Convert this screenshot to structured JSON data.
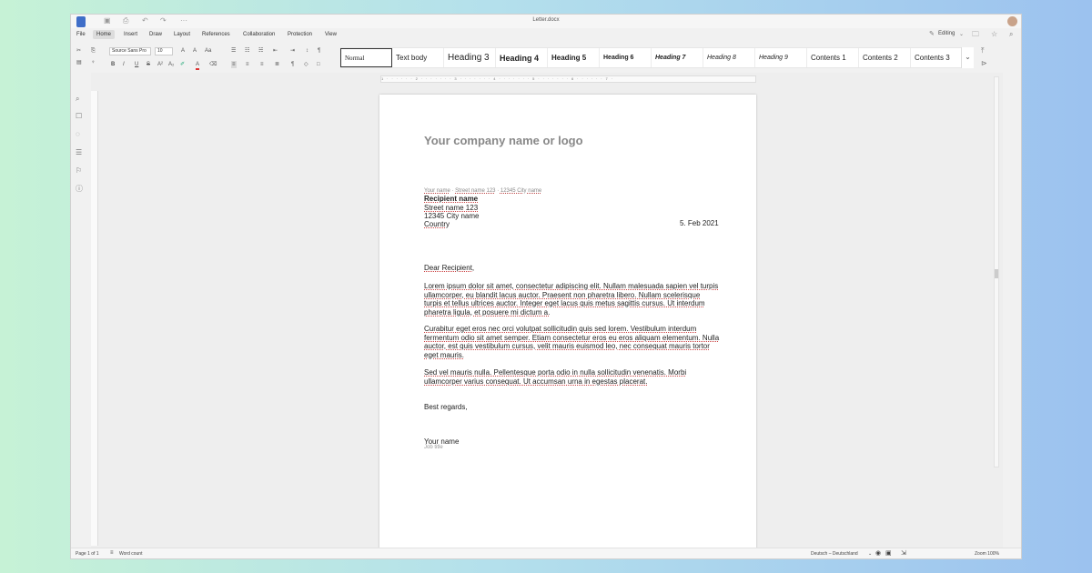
{
  "window": {
    "title": "Letter.docx",
    "zoom": "Zoom 100%"
  },
  "quick_access": {
    "more": "···"
  },
  "menu": {
    "items": [
      {
        "label": "File"
      },
      {
        "label": "Home"
      },
      {
        "label": "Insert"
      },
      {
        "label": "Draw"
      },
      {
        "label": "Layout"
      },
      {
        "label": "References"
      },
      {
        "label": "Collaboration"
      },
      {
        "label": "Protection"
      },
      {
        "label": "View"
      }
    ],
    "active": "Home",
    "editing": "Editing"
  },
  "toolbar": {
    "font": "Source Sans Pro",
    "size": "10",
    "bold": "B",
    "italic": "I",
    "underline": "U",
    "strike": "S",
    "superscript": "A²",
    "subscript": "A₂",
    "font_color": "A"
  },
  "styles": [
    {
      "label": "Normal"
    },
    {
      "label": "Text body"
    },
    {
      "label": "Heading 3"
    },
    {
      "label": "Heading 4"
    },
    {
      "label": "Heading 5"
    },
    {
      "label": "Heading 6"
    },
    {
      "label": "Heading 7"
    },
    {
      "label": "Heading 8"
    },
    {
      "label": "Heading 9"
    },
    {
      "label": "Contents 1"
    },
    {
      "label": "Contents 2"
    },
    {
      "label": "Contents 3"
    }
  ],
  "ruler": {
    "ticks": "1 · · · · · · 2 · · · · · · · 3 · · · · · · · 4 · · · · · · · 5 · · · · · · · 6 · · · · · · 7 ·"
  },
  "document": {
    "company": "Your company name or logo",
    "sender": {
      "name": "Your name",
      "street": "Street name 123",
      "city": "12345 City name"
    },
    "recipient": {
      "name": "Recipient name",
      "street": "Street name 123",
      "city": "12345 City name",
      "country": "Country"
    },
    "date": "5. Feb 2021",
    "salutation": "Dear Recipient,",
    "paragraphs": [
      "Lorem ipsum dolor sit amet, consectetur adipiscing elit. Nullam malesuada sapien vel turpis ullamcorper, eu blandit lacus auctor. Praesent non pharetra libero. Nullam scelerisque turpis et tellus ultrices auctor. Integer eget lacus quis metus sagittis cursus. Ut interdum pharetra ligula, et posuere mi dictum a.",
      "Curabitur eget eros nec orci volutpat sollicitudin quis sed lorem. Vestibulum interdum fermentum odio sit amet semper. Etiam consectetur eros eu eros aliquam elementum. Nulla auctor, est quis vestibulum cursus, velit mauris euismod leo, nec consequat mauris tortor eget mauris.",
      "Sed vel mauris nulla. Pellentesque porta odio in nulla sollicitudin venenatis. Morbi ullamcorper varius consequat. Ut accumsan urna in egestas placerat."
    ],
    "closing": "Best regards,",
    "signature_name": "Your name",
    "job_title": "Job title"
  },
  "status": {
    "page": "Page 1 of 1",
    "word_count": "Word count",
    "language": "Deutsch – Deutschland"
  }
}
